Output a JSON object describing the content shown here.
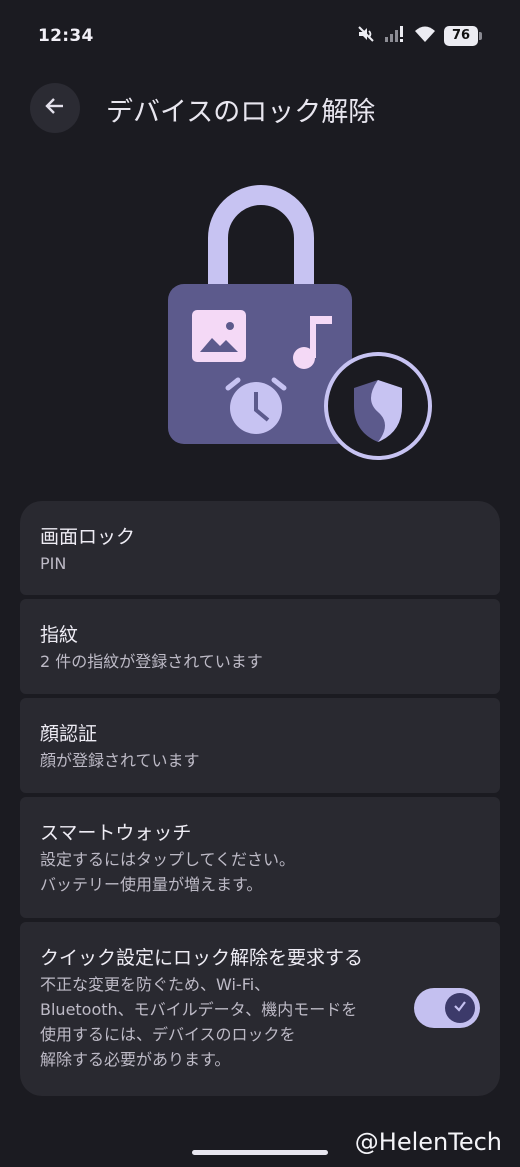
{
  "status_bar": {
    "time": "12:34",
    "battery": "76",
    "icons": [
      "mute-icon",
      "signal-icon",
      "wifi-icon",
      "battery-icon"
    ]
  },
  "app_bar": {
    "back_icon": "arrow-back-icon",
    "title": "デバイスのロック解除"
  },
  "hero": {
    "icons": [
      "padlock-illustration",
      "image-icon",
      "music-note-icon",
      "alarm-clock-icon",
      "shield-icon"
    ]
  },
  "settings": [
    {
      "title": "画面ロック",
      "subtitle": "PIN"
    },
    {
      "title": "指紋",
      "subtitle": "2 件の指紋が登録されています"
    },
    {
      "title": "顔認証",
      "subtitle": "顔が登録されています"
    },
    {
      "title": "スマートウォッチ",
      "subtitle": "設定するにはタップしてください。\nバッテリー使用量が増えます。"
    },
    {
      "title": "クイック設定にロック解除を要求する",
      "subtitle": "不正な変更を防ぐため、Wi-Fi、\nBluetooth、モバイルデータ、機内モードを\n使用するには、デバイスのロックを\n解除する必要があります。",
      "toggle_on": true
    }
  ],
  "watermark": "@HelenTech",
  "colors": {
    "background": "#1b1b21",
    "card": "#292930",
    "accent": "#c4c0f0",
    "illustration": "#5c5a8c"
  }
}
